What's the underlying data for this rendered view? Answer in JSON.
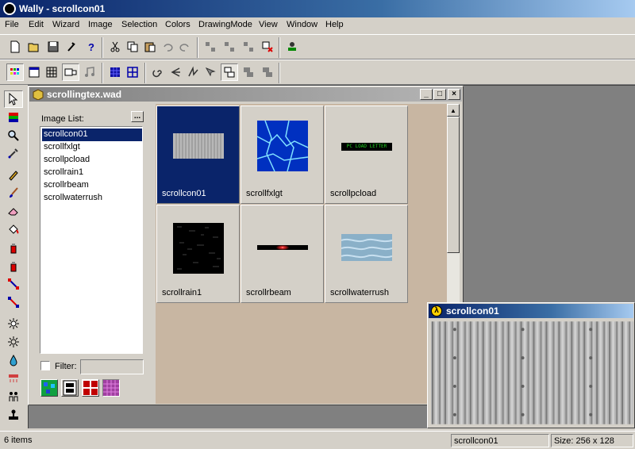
{
  "app": {
    "title": "Wally - scrollcon01"
  },
  "menu": [
    "File",
    "Edit",
    "Wizard",
    "Image",
    "Selection",
    "Colors",
    "DrawingMode",
    "View",
    "Window",
    "Help"
  ],
  "toolbar1": [
    "new-icon",
    "open-icon",
    "save-icon",
    "wizard-icon",
    "help-icon",
    "cut-icon",
    "copy-icon",
    "paste-icon",
    "undo-icon",
    "redo-icon",
    "tool-a-icon",
    "tool-b-icon",
    "tool-c-icon",
    "delete-icon",
    "stamp-icon"
  ],
  "toolbar2": [
    "palette-icon",
    "window-icon",
    "grid-icon",
    "tile-icon",
    "music-icon",
    "grid-blue-icon",
    "grid-outline-icon",
    "spiral-icon",
    "arrow-left-icon",
    "zigzag-icon",
    "cursor-icon",
    "layout-a-icon",
    "layout-b-icon",
    "layout-c-icon"
  ],
  "tools": [
    "pointer",
    "flag",
    "magnifier",
    "eyedropper",
    "pencil",
    "brush",
    "eraser",
    "fill",
    "spray",
    "spray-red",
    "line-red",
    "line-blue",
    "sun",
    "sun-outline",
    "drop",
    "rain",
    "people",
    "stamp"
  ],
  "wad": {
    "title": "scrollingtex.wad",
    "list_label": "Image List:",
    "more_button": "...",
    "items": [
      "scrollcon01",
      "scrollfxlgt",
      "scrollpcload",
      "scrollrain1",
      "scrollrbeam",
      "scrollwaterrush"
    ],
    "selected_index": 0,
    "filter_label": "Filter:",
    "filter_value": "",
    "thumbnails": [
      {
        "name": "scrollcon01"
      },
      {
        "name": "scrollfxlgt"
      },
      {
        "name": "scrollpcload",
        "text": "PC LOAD LETTER"
      },
      {
        "name": "scrollrain1"
      },
      {
        "name": "scrollrbeam"
      },
      {
        "name": "scrollwaterrush"
      }
    ]
  },
  "preview": {
    "title": "scrollcon01"
  },
  "status": {
    "items": "6 items",
    "image_name": "scrollcon01",
    "size": "Size: 256 x 128"
  },
  "window_controls": {
    "minimize": "_",
    "maximize": "□",
    "close": "×"
  }
}
